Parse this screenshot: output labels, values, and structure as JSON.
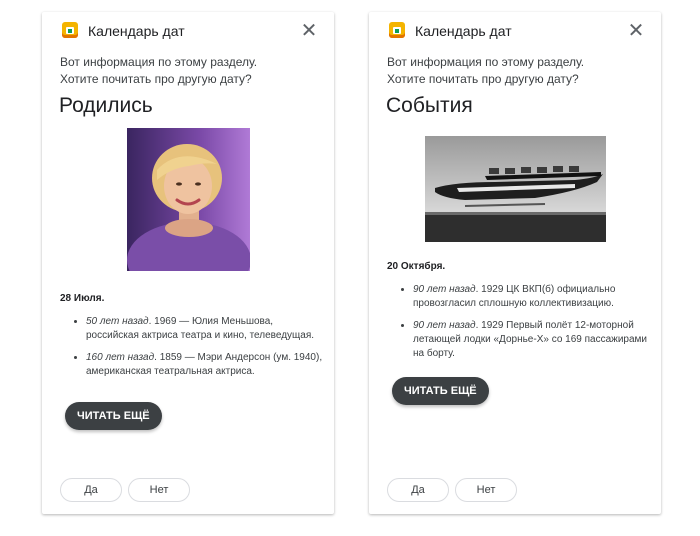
{
  "cards": [
    {
      "app_title": "Календарь дат",
      "intro_line1": "Вот информация по этому разделу.",
      "intro_line2": "Хотите почитать про другую дату?",
      "heading": "Родились",
      "date": "28 Июля.",
      "facts": [
        {
          "ago": "50 лет назад",
          "text": ". 1969 — Юлия Меньшова, российская актриса театра и кино, телеведущая."
        },
        {
          "ago": "160 лет назад",
          "text": ". 1859 — Мэри Андерсон (ум. 1940), американская театральная актриса."
        }
      ],
      "more_label": "ЧИТАТЬ ЕЩЁ",
      "yes_label": "Да",
      "no_label": "Нет"
    },
    {
      "app_title": "Календарь дат",
      "intro_line1": "Вот информация по этому разделу.",
      "intro_line2": "Хотите почитать про другую дату?",
      "heading": "События",
      "date": "20 Октября.",
      "facts": [
        {
          "ago": "90 лет назад",
          "text": ". 1929 ЦК ВКП(б) официально провозгласил сплошную коллективизацию."
        },
        {
          "ago": "90 лет назад",
          "text": ". 1929 Первый полёт 12-моторной летающей лодки «Дорнье-Х» со 169 пассажирами на борту."
        }
      ],
      "more_label": "ЧИТАТЬ ЕЩЁ",
      "yes_label": "Да",
      "no_label": "Нет"
    }
  ],
  "icons": {
    "app": "calendar-app-icon",
    "close": "close-icon"
  }
}
